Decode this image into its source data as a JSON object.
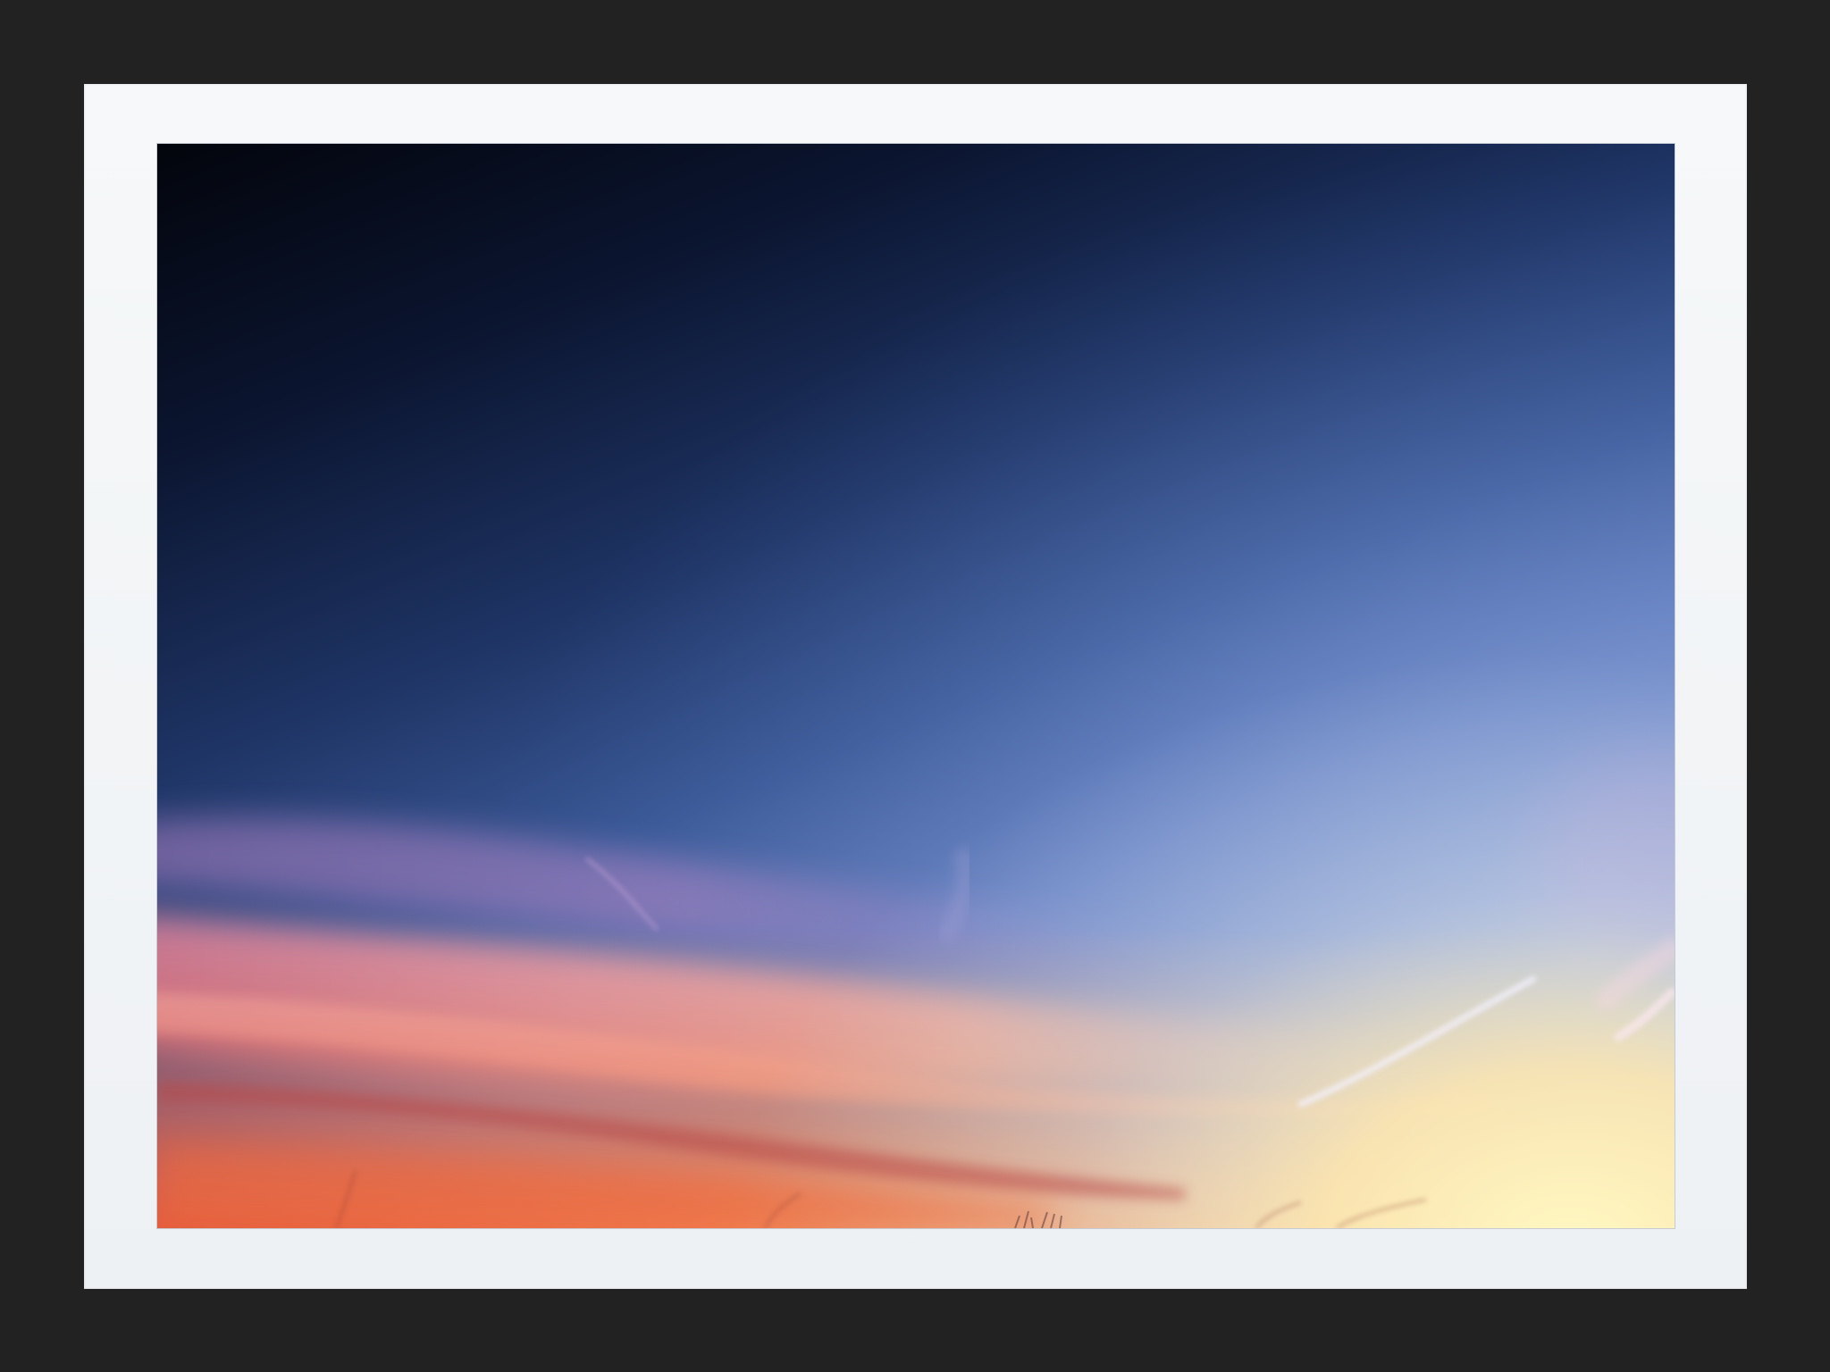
{
  "image": {
    "subject": "sunset-sky",
    "colors": {
      "frame": "#222222",
      "mat": "#f3f5f7",
      "sky_top": "#05070f",
      "sky_mid": "#2e4a86",
      "sky_light": "#7f9bd0",
      "cloud_pink": "#e79aa8",
      "horizon_orange": "#ef7a48",
      "horizon_yellow": "#fff3b0"
    }
  }
}
